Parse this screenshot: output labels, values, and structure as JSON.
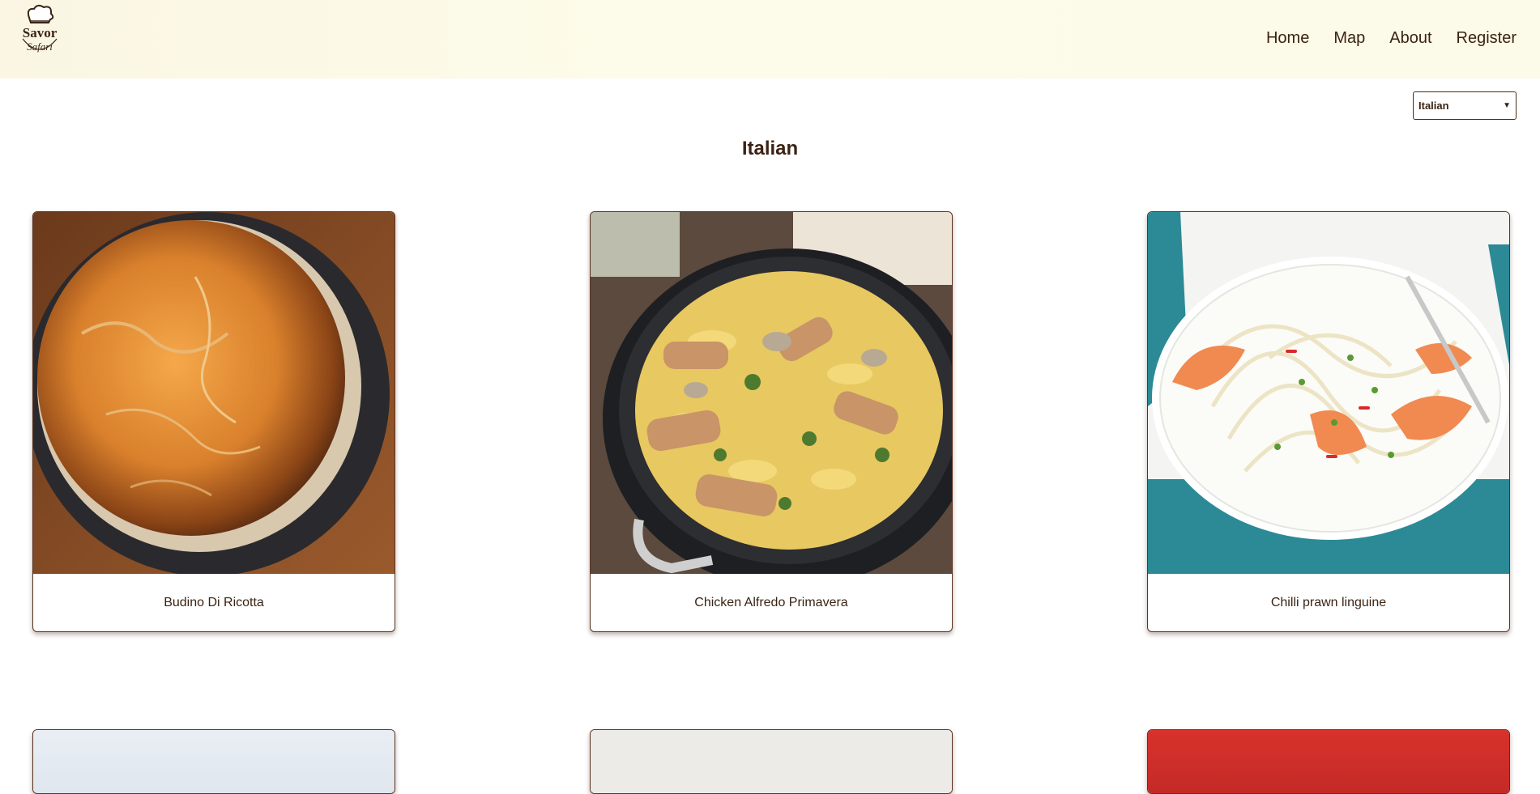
{
  "header": {
    "logo_text": [
      "Savor",
      "Safari"
    ],
    "nav": [
      {
        "label": "Home"
      },
      {
        "label": "Map"
      },
      {
        "label": "About"
      },
      {
        "label": "Register"
      }
    ]
  },
  "filter": {
    "selected": "Italian",
    "icon": "chevron-down-icon"
  },
  "page_title": "Italian",
  "recipes": [
    {
      "name": "Budino Di Ricotta"
    },
    {
      "name": "Chicken Alfredo Primavera"
    },
    {
      "name": "Chilli prawn linguine"
    }
  ],
  "colors": {
    "text_brown": "#3b2314",
    "header_bg": "#fcfae8",
    "card_border": "#5a3320"
  }
}
